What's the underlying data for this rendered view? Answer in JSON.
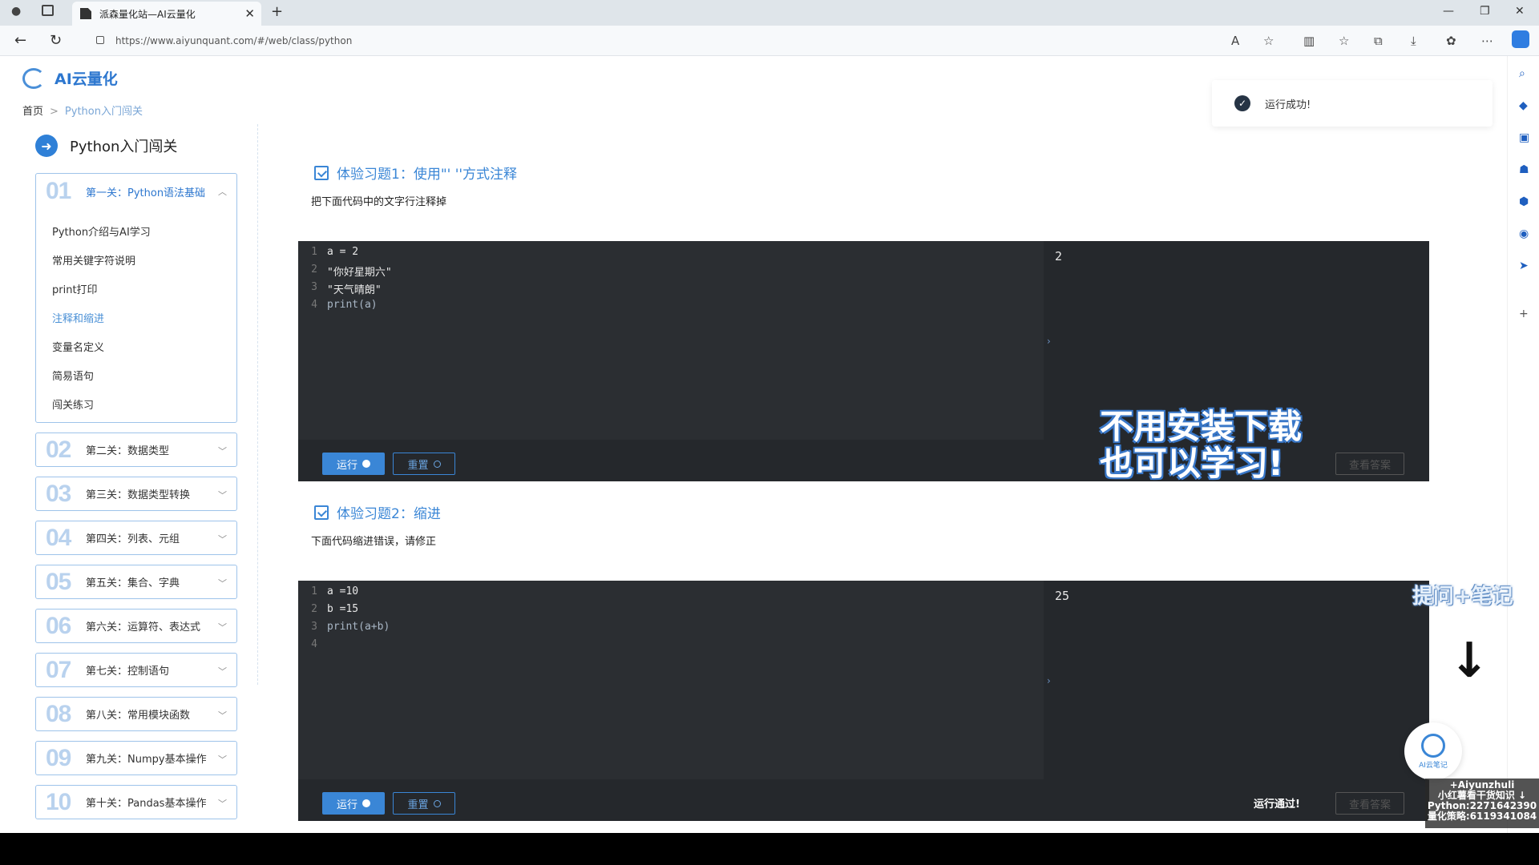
{
  "browser": {
    "tab_title": "派森量化站—AI云量化",
    "new_tab": "+",
    "close": "✕",
    "url": "https://www.aiyunquant.com/#/web/class/python"
  },
  "site": {
    "logo_text": "AI云量化",
    "breadcrumb": {
      "home": "首页",
      "current": "Python入门闯关"
    }
  },
  "sidebar": {
    "title": "Python入门闯关",
    "open_level": {
      "num": "01",
      "name": "第一关：Python语法基础",
      "items": [
        {
          "label": "Python介绍与AI学习",
          "active": false
        },
        {
          "label": "常用关键字符说明",
          "active": false
        },
        {
          "label": "print打印",
          "active": false
        },
        {
          "label": "注释和缩进",
          "active": true
        },
        {
          "label": "变量名定义",
          "active": false
        },
        {
          "label": "简易语句",
          "active": false
        },
        {
          "label": "闯关练习",
          "active": false
        }
      ]
    },
    "levels": [
      {
        "num": "02",
        "name": "第二关：数据类型"
      },
      {
        "num": "03",
        "name": "第三关：数据类型转换"
      },
      {
        "num": "04",
        "name": "第四关：列表、元组"
      },
      {
        "num": "05",
        "name": "第五关：集合、字典"
      },
      {
        "num": "06",
        "name": "第六关：运算符、表达式"
      },
      {
        "num": "07",
        "name": "第七关：控制语句"
      },
      {
        "num": "08",
        "name": "第八关：常用模块函数"
      },
      {
        "num": "09",
        "name": "第九关：Numpy基本操作"
      },
      {
        "num": "10",
        "name": "第十关：Pandas基本操作"
      }
    ]
  },
  "exercises": [
    {
      "title": "体验习题1：使用\"' ''方式注释",
      "desc": "把下面代码中的文字行注释掉",
      "lines": [
        "a = 2",
        "\"你好星期六\"",
        "\"天气晴朗\"",
        "print(a)"
      ],
      "output": "2",
      "run_label": "运行",
      "reset_label": "重置",
      "answer_label": "查看答案",
      "status": ""
    },
    {
      "title": "体验习题2：缩进",
      "desc": "下面代码缩进错误，请修正",
      "lines": [
        "a =10",
        "b =15",
        "print(a+b)",
        ""
      ],
      "output": "25",
      "run_label": "运行",
      "reset_label": "重置",
      "answer_label": "查看答案",
      "status": "运行通过!"
    }
  ],
  "toast": {
    "text": "运行成功!"
  },
  "overlays": {
    "promo_line1": "不用安装下载",
    "promo_line2": "也可以学习!",
    "note": "提问+笔记",
    "circle_label": "AI云笔记",
    "contact_lines": [
      "+Aiyunzhuli",
      "小红薯看干货知识 ↓",
      "Python:2271642390",
      "量化策略:6119341084"
    ]
  },
  "icons": {
    "back": "arrow-left-icon",
    "refresh": "refresh-icon",
    "lock": "lock-icon",
    "more": "more-icon",
    "check": "check-icon"
  },
  "colors": {
    "accent": "#3a86d6",
    "editor_bg": "#25282c",
    "code_bg": "#2b2e32"
  }
}
